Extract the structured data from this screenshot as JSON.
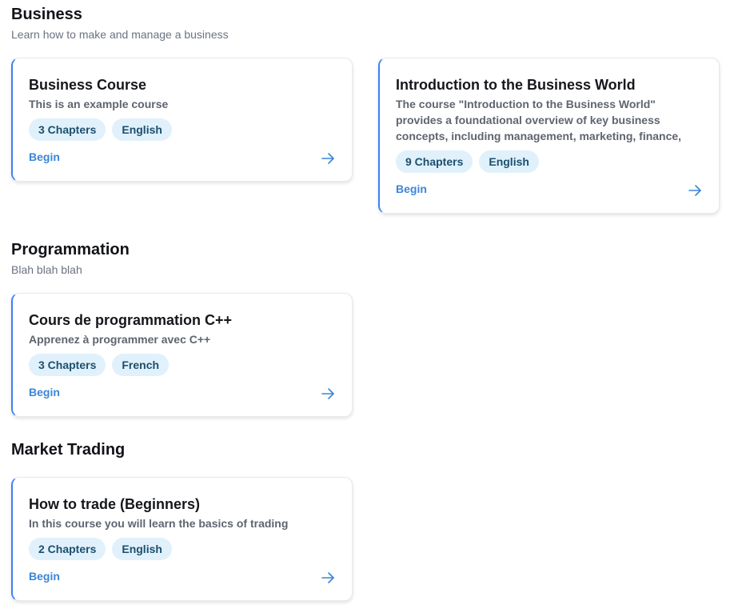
{
  "sections": [
    {
      "title": "Business",
      "subtitle": "Learn how to make and manage a business",
      "courses": [
        {
          "title": "Business Course",
          "description": "This is an example course",
          "chapters": "3 Chapters",
          "language": "English",
          "action": "Begin"
        },
        {
          "title": "Introduction to the Business World",
          "description": "The course \"Introduction to the Business World\" provides a foundational overview of key business concepts, including management, marketing, finance,",
          "chapters": "9 Chapters",
          "language": "English",
          "action": "Begin"
        }
      ]
    },
    {
      "title": "Programmation",
      "subtitle": "Blah blah blah",
      "courses": [
        {
          "title": "Cours de programmation C++",
          "description": "Apprenez à programmer avec C++",
          "chapters": "3 Chapters",
          "language": "French",
          "action": "Begin"
        }
      ]
    },
    {
      "title": "Market Trading",
      "subtitle": "",
      "courses": [
        {
          "title": "How to trade (Beginners)",
          "description": "In this course you will learn the basics of trading",
          "chapters": "2 Chapters",
          "language": "English",
          "action": "Begin"
        }
      ]
    }
  ],
  "colors": {
    "accent": "#3b82f6",
    "link": "#3a86d8",
    "tag_bg": "#e0f1fb",
    "tag_text": "#1c4f6e"
  },
  "icons": {
    "card_arrow": "arrow-right-icon"
  }
}
